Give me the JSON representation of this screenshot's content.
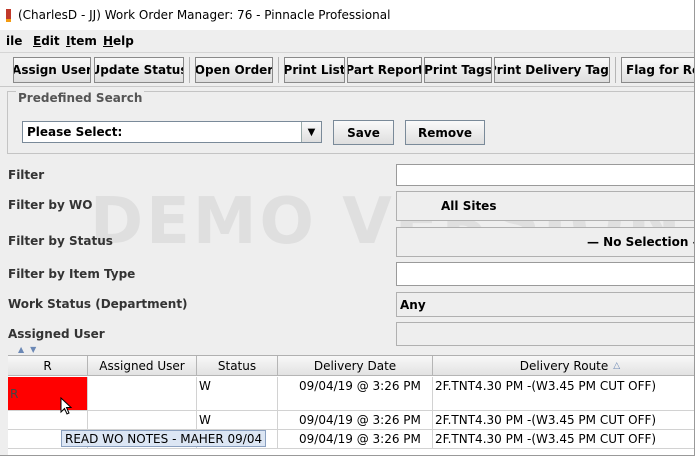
{
  "window": {
    "title": "(CharlesD - JJ) Work Order Manager: 76 - Pinnacle Professional"
  },
  "menu": [
    {
      "label": "ile",
      "mnemonic": ""
    },
    {
      "label": "dit",
      "mnemonic": "E"
    },
    {
      "label": "tem",
      "mnemonic": "I"
    },
    {
      "label": "elp",
      "mnemonic": "H"
    }
  ],
  "toolbar": {
    "assign_user": "Assign User",
    "update_status": "Update Status",
    "open_order": "Open Order",
    "print_list": "Print List",
    "part_report": "Part Report",
    "print_tags": "Print Tags",
    "print_delivery_tags": "Print Delivery Tags",
    "flag_for_re": "Flag for Re"
  },
  "predefined_search": {
    "legend": "Predefined Search",
    "selected": "Please Select:",
    "save": "Save",
    "remove": "Remove"
  },
  "filters": {
    "filter": {
      "label": "Filter",
      "value": ""
    },
    "filter_by_wo": {
      "label": "Filter by WO",
      "value": "All Sites"
    },
    "filter_by_status": {
      "label": "Filter by Status",
      "value": "— No Selection —"
    },
    "filter_by_item_type": {
      "label": "Filter by Item Type",
      "value": ""
    },
    "work_status": {
      "label": "Work Status (Department)",
      "value": "Any"
    },
    "assigned_user": {
      "label": "Assigned User",
      "value": ""
    }
  },
  "watermark": "DEMO VERSION",
  "table": {
    "columns": [
      "R",
      "Assigned User",
      "Status",
      "Delivery Date",
      "Delivery Route"
    ],
    "rows": [
      {
        "r": "R",
        "assigned_user": "",
        "status": "W",
        "delivery_date": "09/04/19 @ 3:26 PM",
        "delivery_route": "2F.TNT4.30 PM  -(W3.45 PM CUT OFF)",
        "highlight": "#ff0000"
      },
      {
        "r": "",
        "assigned_user": "",
        "status": "W",
        "delivery_date": "09/04/19 @ 3:26 PM",
        "delivery_route": "2F.TNT4.30 PM  -(W3.45 PM CUT OFF)"
      },
      {
        "r": "",
        "assigned_user": "",
        "status": "W",
        "delivery_date": "09/04/19 @ 3:26 PM",
        "delivery_route": "2F.TNT4.30 PM  -(W3.45 PM CUT OFF)"
      }
    ]
  },
  "tooltip": "READ WO NOTES - MAHER 09/04"
}
